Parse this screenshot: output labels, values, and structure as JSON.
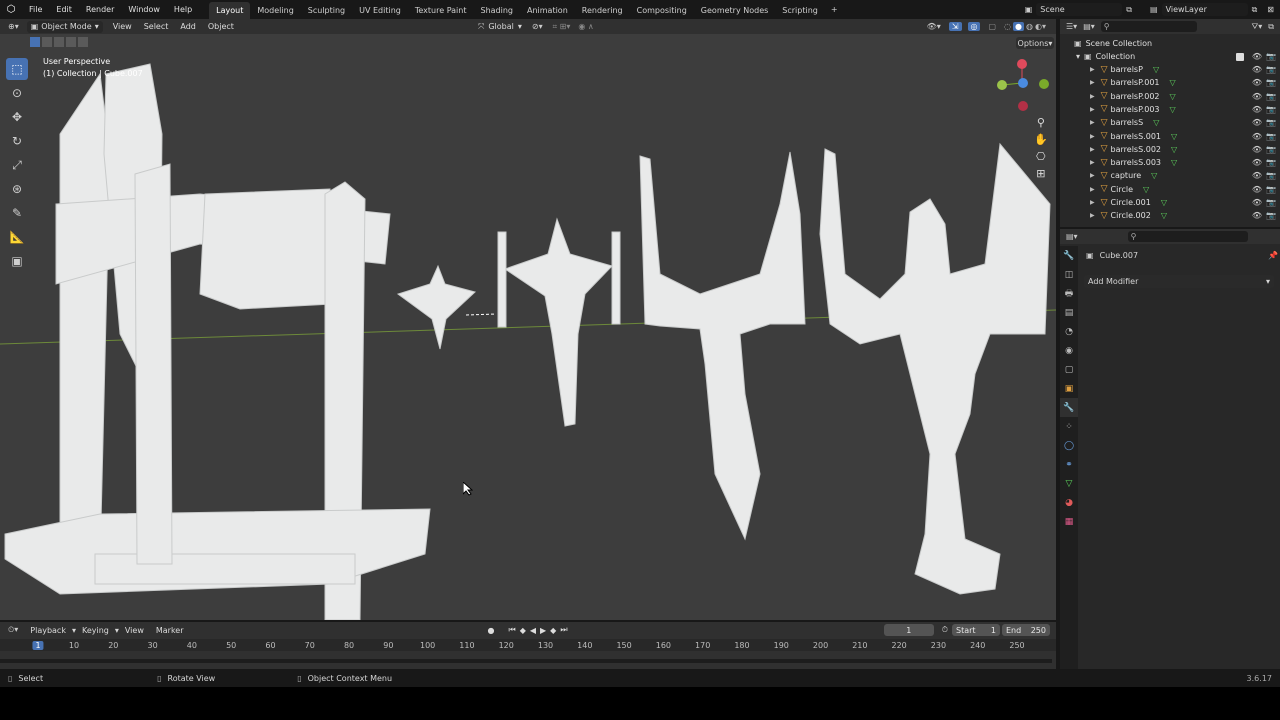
{
  "menu": {
    "file": "File",
    "edit": "Edit",
    "render": "Render",
    "window": "Window",
    "help": "Help"
  },
  "workspaces": [
    "Layout",
    "Modeling",
    "Sculpting",
    "UV Editing",
    "Texture Paint",
    "Shading",
    "Animation",
    "Rendering",
    "Compositing",
    "Geometry Nodes",
    "Scripting"
  ],
  "active_workspace": "Layout",
  "scene": "Scene",
  "view_layer": "ViewLayer",
  "viewport_header": {
    "mode": "Object Mode",
    "view": "View",
    "select": "Select",
    "add": "Add",
    "object": "Object",
    "orientation": "Global",
    "options": "Options"
  },
  "viewport_overlay": {
    "perspective": "User Perspective",
    "collection_info": "(1) Collection | Cube.007"
  },
  "outliner": {
    "scene_collection": "Scene Collection",
    "collection": "Collection",
    "items": [
      "barrelsP",
      "barrelsP.001",
      "barrelsP.002",
      "barrelsP.003",
      "barrelsS",
      "barrelsS.001",
      "barrelsS.002",
      "barrelsS.003",
      "capture",
      "Circle",
      "Circle.001",
      "Circle.002"
    ]
  },
  "properties": {
    "object_name": "Cube.007",
    "add_modifier": "Add Modifier"
  },
  "timeline": {
    "playback": "Playback",
    "keying": "Keying",
    "view": "View",
    "marker": "Marker",
    "current_frame": "1",
    "start_label": "Start",
    "start": "1",
    "end_label": "End",
    "end": "250",
    "ruler": [
      "1",
      "10",
      "20",
      "30",
      "40",
      "50",
      "60",
      "70",
      "80",
      "90",
      "100",
      "110",
      "120",
      "130",
      "140",
      "150",
      "160",
      "170",
      "180",
      "190",
      "200",
      "210",
      "220",
      "230",
      "240",
      "250"
    ]
  },
  "statusbar": {
    "select": "Select",
    "rotate": "Rotate View",
    "context": "Object Context Menu",
    "version": "3.6.17"
  },
  "colors": {
    "accent": "#4772b3",
    "mesh_icon": "#5cd05c",
    "object_icon": "#e0a040",
    "viewport_bg": "#3d3d3d",
    "model": "#e9eaea"
  }
}
